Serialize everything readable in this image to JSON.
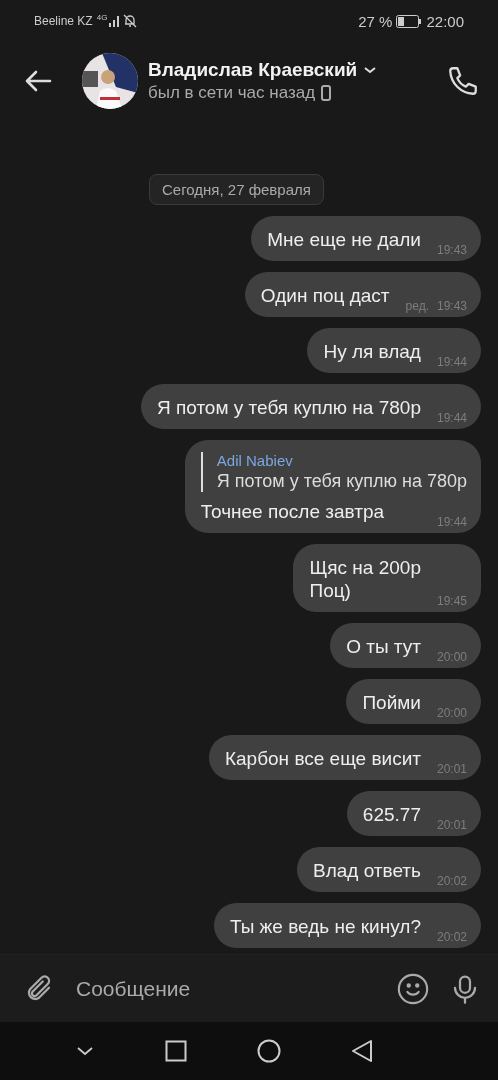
{
  "status_bar": {
    "carrier": "Beeline KZ",
    "network": "4G",
    "battery_percent": "27 %",
    "time": "22:00"
  },
  "header": {
    "name": "Владислав Краевский",
    "status": "был в сети час назад"
  },
  "date_label": "Сегодня, 27 февраля",
  "messages": [
    {
      "text": "Мне еще не дали",
      "time": "19:43"
    },
    {
      "text": "Один поц даст",
      "time": "19:43",
      "edited": "ред."
    },
    {
      "text": "Ну ля влад",
      "time": "19:44"
    },
    {
      "text": "Я потом у тебя куплю на 780р",
      "time": "19:44"
    },
    {
      "text": "Точнее после завтра",
      "time": "19:44",
      "reply": {
        "author": "Adil Nabiev",
        "text": "Я потом у тебя куплю на 780р"
      }
    },
    {
      "text": "Щяс на 200р\nПоц)",
      "time": "19:45"
    },
    {
      "text": "О ты тут",
      "time": "20:00"
    },
    {
      "text": "Пойми",
      "time": "20:00"
    },
    {
      "text": "Карбон все еще висит",
      "time": "20:01"
    },
    {
      "text": "625.77",
      "time": "20:01"
    },
    {
      "text": "Влад ответь",
      "time": "20:02"
    },
    {
      "text": "Ты же ведь не кинул?",
      "time": "20:02"
    }
  ],
  "composer": {
    "placeholder": "Сообщение"
  }
}
